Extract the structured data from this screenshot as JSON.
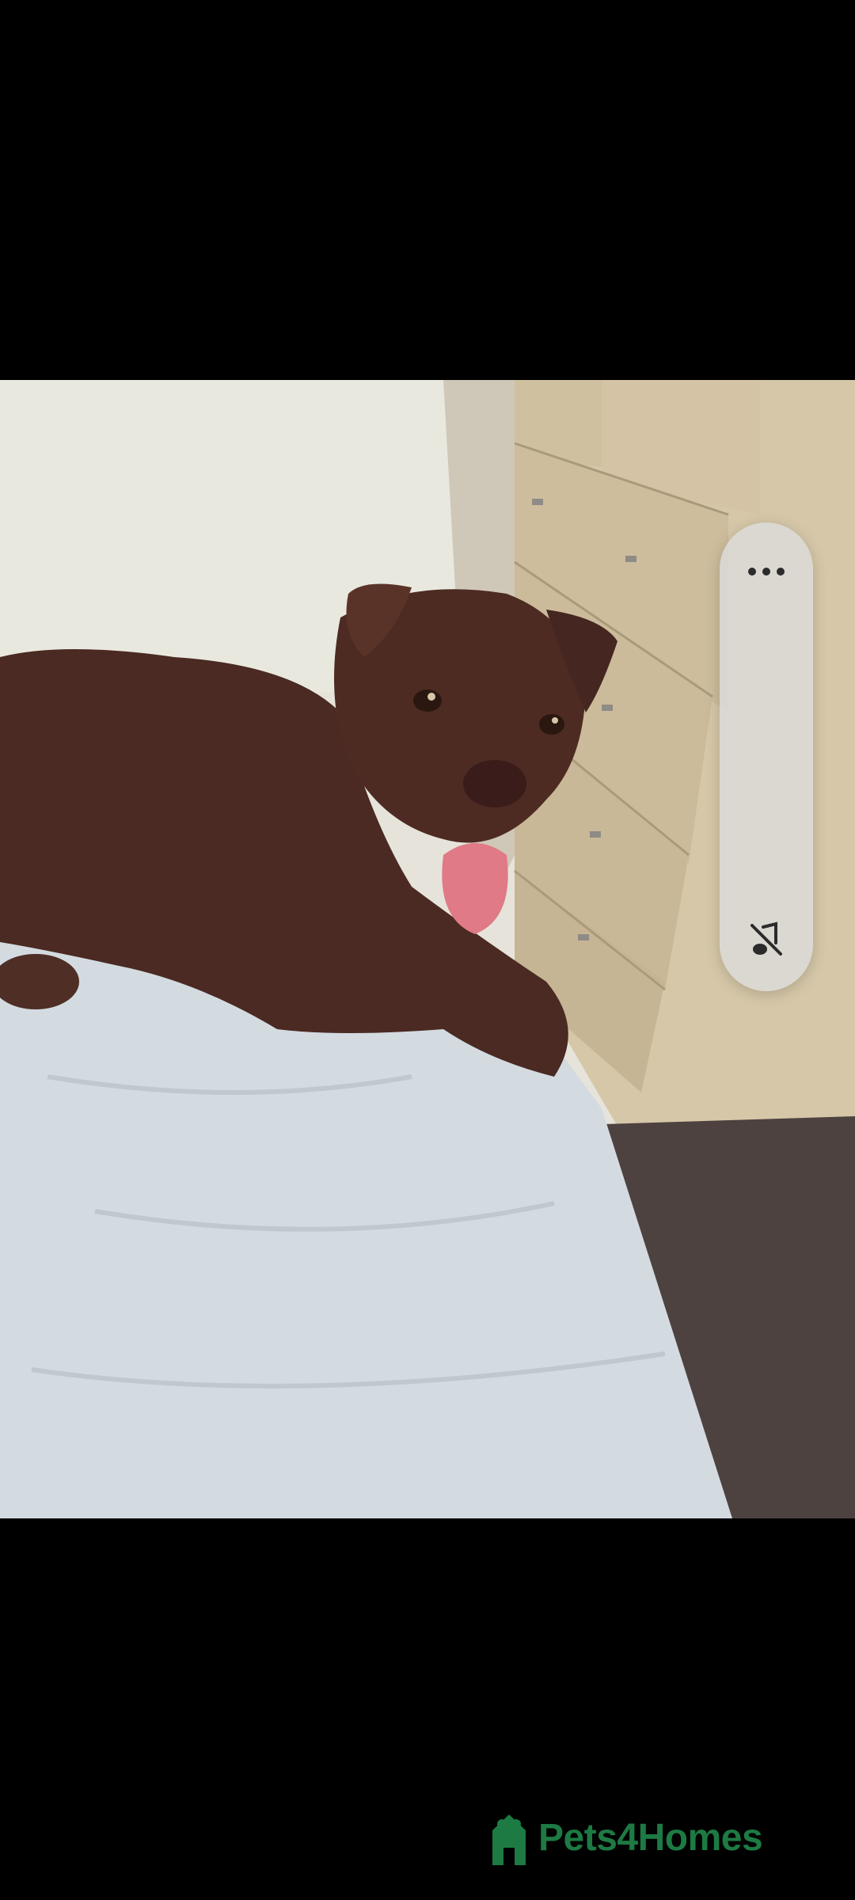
{
  "media": {
    "description_alt": "photo",
    "type": "image"
  },
  "controls": {
    "more_icon": "more-horizontal-icon",
    "mute_icon": "volume-muted-icon"
  },
  "watermark": {
    "text": "Pets4Homes",
    "color": "#1d7a43"
  }
}
